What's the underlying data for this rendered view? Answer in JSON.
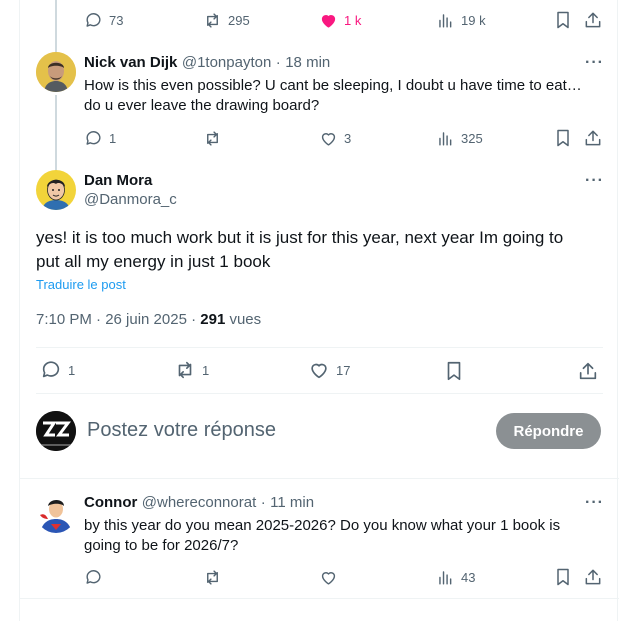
{
  "top_tweet": {
    "replies": "73",
    "reposts": "295",
    "likes": "1 k",
    "views": "19 k"
  },
  "reply1": {
    "name": "Nick van Dijk",
    "handle": "@1tonpayton",
    "time": "18 min",
    "text_line1": "How is this even possible? U cant be sleeping, I doubt u have time to eat…",
    "text_line2": "do u ever leave the drawing board?",
    "replies": "1",
    "reposts": "",
    "likes": "3",
    "views": "325"
  },
  "main_tweet": {
    "name": "Dan Mora",
    "handle": "@Danmora_c",
    "text_line1": "yes! it is too much work but it is just for this year, next year Im going to",
    "text_line2": "put all my energy in just 1 book",
    "translate": "Traduire le post",
    "timestamp": "7:10 PM · 26 juin 2025 · ",
    "views_count": "291",
    "views_label": " vues",
    "replies": "1",
    "reposts": "1",
    "likes": "17"
  },
  "composer": {
    "placeholder": "Postez votre réponse",
    "button": "Répondre"
  },
  "reply2": {
    "name": "Connor",
    "handle": "@whereconnorat",
    "time": "11 min",
    "text_line1": "by this year do you mean 2025-2026? Do you know what your 1 book is",
    "text_line2": "going to be for 2026/7?",
    "views": "43"
  },
  "colors": {
    "like_pink": "#f91880",
    "link_blue": "#1d9bf0",
    "secondary": "#536471",
    "button_grey": "#8b9093"
  }
}
